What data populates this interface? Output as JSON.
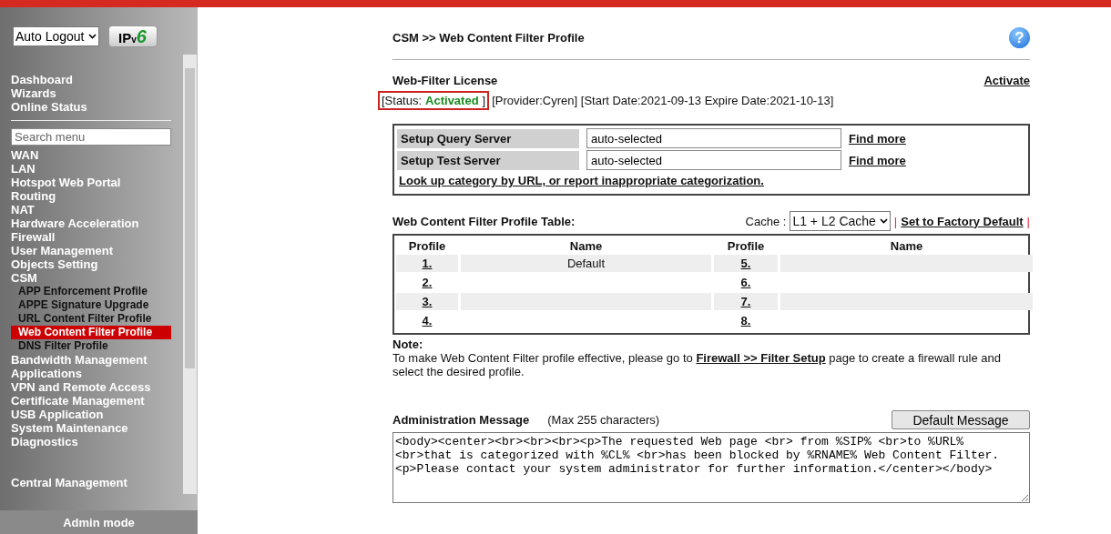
{
  "sidebar": {
    "logout_select": "Auto Logout",
    "ipv6_button": {
      "part_1": "IP",
      "part_2": "v",
      "part_3": "6"
    },
    "top_items": [
      {
        "label": "Dashboard"
      },
      {
        "label": "Wizards"
      },
      {
        "label": "Online Status"
      }
    ],
    "search": {
      "placeholder": "Search menu"
    },
    "items": [
      {
        "label": "WAN"
      },
      {
        "label": "LAN"
      },
      {
        "label": "Hotspot Web Portal"
      },
      {
        "label": "Routing"
      },
      {
        "label": "NAT"
      },
      {
        "label": "Hardware Acceleration"
      },
      {
        "label": "Firewall"
      },
      {
        "label": "User Management"
      },
      {
        "label": "Objects Setting"
      },
      {
        "label": "CSM",
        "children": [
          {
            "label": "APP Enforcement Profile",
            "selected": false
          },
          {
            "label": "APPE Signature Upgrade",
            "selected": false
          },
          {
            "label": "URL Content Filter Profile",
            "selected": false
          },
          {
            "label": "Web Content Filter Profile",
            "selected": true
          },
          {
            "label": "DNS Filter Profile",
            "selected": false
          }
        ]
      },
      {
        "label": "Bandwidth Management"
      },
      {
        "label": "Applications"
      },
      {
        "label": "VPN and Remote Access"
      },
      {
        "label": "Certificate Management"
      },
      {
        "label": "USB Application"
      },
      {
        "label": "System Maintenance"
      },
      {
        "label": "Diagnostics"
      }
    ],
    "bottom_items": [
      {
        "label": "Central Management"
      }
    ],
    "mode": "Admin mode"
  },
  "page": {
    "breadcrumb": "CSM >> Web Content Filter Profile",
    "help_icon": "?",
    "license": {
      "title": "Web-Filter License",
      "activate_link": "Activate",
      "status_open": "[Status:",
      "status_value": "Activated",
      "status_close": "]",
      "details": "[Provider:Cyren] [Start Date:2021-09-13 Expire Date:2021-10-13]"
    },
    "servers": [
      {
        "label": "Setup Query Server",
        "value": "auto-selected",
        "link": "Find more"
      },
      {
        "label": "Setup Test Server",
        "value": "auto-selected",
        "link": "Find more"
      }
    ],
    "lookup_link": "Look up category by URL, or report inappropriate categorization.",
    "table": {
      "title": "Web Content Filter Profile Table:",
      "cache_label": "Cache :",
      "cache_value": "L1 + L2 Cache",
      "separator": "|",
      "factory_link": "Set to Factory Default",
      "separator_2": "|",
      "columns": [
        "Profile",
        "Name",
        "Profile",
        "Name"
      ],
      "rows": [
        {
          "profile_1": "1.",
          "name_1": "Default",
          "profile_2": "5."
        },
        {
          "profile_1": "2.",
          "profile_2": "6."
        },
        {
          "profile_1": "3.",
          "profile_2": "7."
        },
        {
          "profile_1": "4.",
          "profile_2": "8."
        }
      ]
    },
    "note": {
      "title": "Note:",
      "before": "To make Web Content Filter profile effective, please go to",
      "link": "Firewall >> Filter Setup",
      "after": "page to create a firewall rule and select the desired profile."
    },
    "admin_message": {
      "title": "Administration Message",
      "hint": "(Max 255 characters)",
      "button": "Default Message",
      "value": "<body><center><br><br><br><p>The requested Web page <br> from %SIP% <br>to %URL% <br>that is categorized with %CL% <br>has been blocked by %RNAME% Web Content Filter. <p>Please contact your system administrator for further information.</center></body>"
    }
  }
}
